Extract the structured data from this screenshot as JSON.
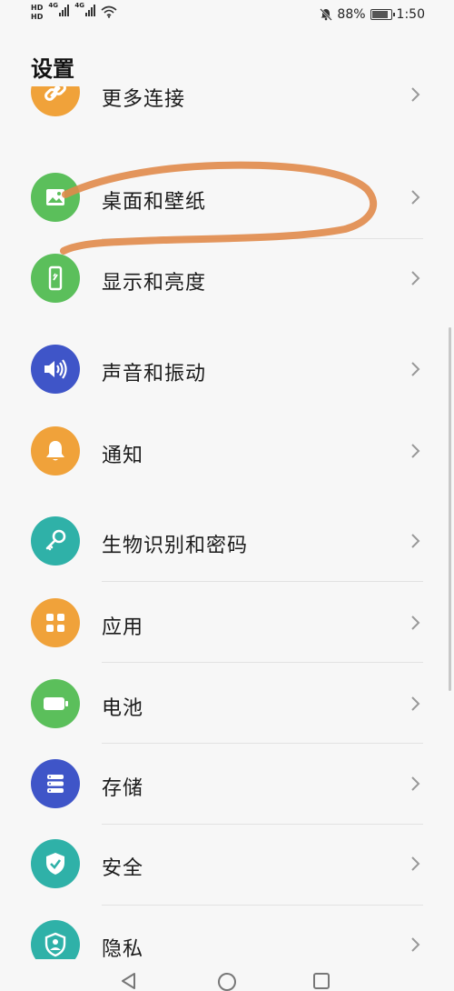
{
  "status_bar": {
    "hd_top": "HD",
    "hd_bottom": "HD",
    "net1": "4G",
    "net2": "4G",
    "battery_pct": "88%",
    "battery_level": 0.88,
    "time": "1:50"
  },
  "page": {
    "title": "设置"
  },
  "items": [
    {
      "label": "更多连接",
      "icon": "link-icon",
      "color": "#f0a23a"
    },
    {
      "label": "桌面和壁纸",
      "icon": "wallpaper-icon",
      "color": "#5bbf5b"
    },
    {
      "label": "显示和亮度",
      "icon": "phone-brightness-icon",
      "color": "#5bbf5b"
    },
    {
      "label": "声音和振动",
      "icon": "speaker-icon",
      "color": "#3f55c8"
    },
    {
      "label": "通知",
      "icon": "bell-icon",
      "color": "#f0a23a"
    },
    {
      "label": "生物识别和密码",
      "icon": "key-icon",
      "color": "#2fb1a8"
    },
    {
      "label": "应用",
      "icon": "apps-grid-icon",
      "color": "#f0a23a"
    },
    {
      "label": "电池",
      "icon": "battery-icon",
      "color": "#5bbf5b"
    },
    {
      "label": "存储",
      "icon": "storage-icon",
      "color": "#3f55c8"
    },
    {
      "label": "安全",
      "icon": "shield-check-icon",
      "color": "#2fb1a8"
    },
    {
      "label": "隐私",
      "icon": "privacy-shield-icon",
      "color": "#2fb1a8"
    }
  ],
  "annotation_color": "#e08a4a"
}
